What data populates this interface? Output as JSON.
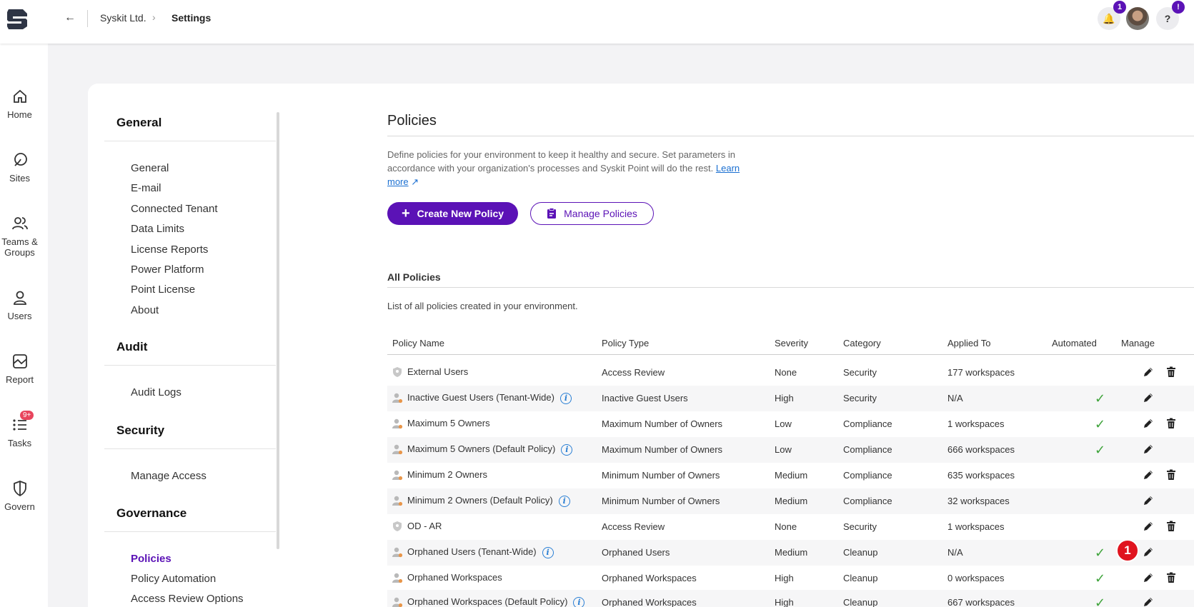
{
  "topbar": {
    "breadcrumb_org": "Syskit Ltd.",
    "breadcrumb_page": "Settings",
    "notifications_badge": "1",
    "help_badge": "!"
  },
  "leftnav": {
    "items": [
      {
        "label": "Home",
        "icon": "home-icon"
      },
      {
        "label": "Sites",
        "icon": "sites-icon"
      },
      {
        "label": "Teams & Groups",
        "icon": "teams-icon"
      },
      {
        "label": "Users",
        "icon": "user-icon"
      },
      {
        "label": "Report",
        "icon": "report-icon"
      },
      {
        "label": "Tasks",
        "icon": "tasks-icon",
        "badge": "9+"
      },
      {
        "label": "Govern",
        "icon": "shield-icon"
      }
    ]
  },
  "submenu": {
    "general_title": "General",
    "general_items": [
      "General",
      "E-mail",
      "Connected Tenant",
      "Data Limits",
      "License Reports",
      "Power Platform",
      "Point License",
      "About"
    ],
    "audit_title": "Audit",
    "audit_items": [
      "Audit Logs"
    ],
    "security_title": "Security",
    "security_items": [
      "Manage Access"
    ],
    "governance_title": "Governance",
    "governance_items": [
      "Policies",
      "Policy Automation",
      "Access Review Options"
    ]
  },
  "content": {
    "title": "Policies",
    "description": "Define policies for your environment to keep it healthy and secure. Set parameters in accordance with your organization's processes and Syskit Point will do the rest.",
    "learn_more": "Learn more",
    "create_button": "Create New Policy",
    "manage_button": "Manage Policies",
    "all_policies_title": "All Policies",
    "all_policies_desc": "List of all policies created in your environment."
  },
  "table": {
    "headers": [
      "Policy Name",
      "Policy Type",
      "Severity",
      "Category",
      "Applied To",
      "Automated",
      "Manage"
    ],
    "rows": [
      {
        "name": "External Users",
        "type": "Access Review",
        "severity": "None",
        "category": "Security",
        "applied": "177 workspaces",
        "automated": false,
        "info": false,
        "deletable": true
      },
      {
        "name": "Inactive Guest Users (Tenant-Wide)",
        "type": "Inactive Guest Users",
        "severity": "High",
        "category": "Security",
        "applied": "N/A",
        "automated": true,
        "info": true,
        "deletable": false
      },
      {
        "name": "Maximum 5 Owners",
        "type": "Maximum Number of Owners",
        "severity": "Low",
        "category": "Compliance",
        "applied": "1 workspaces",
        "automated": true,
        "info": false,
        "deletable": true
      },
      {
        "name": "Maximum 5 Owners (Default Policy)",
        "type": "Maximum Number of Owners",
        "severity": "Low",
        "category": "Compliance",
        "applied": "666 workspaces",
        "automated": true,
        "info": true,
        "deletable": false
      },
      {
        "name": "Minimum 2 Owners",
        "type": "Minimum Number of Owners",
        "severity": "Medium",
        "category": "Compliance",
        "applied": "635 workspaces",
        "automated": false,
        "info": false,
        "deletable": true
      },
      {
        "name": "Minimum 2 Owners (Default Policy)",
        "type": "Minimum Number of Owners",
        "severity": "Medium",
        "category": "Compliance",
        "applied": "32 workspaces",
        "automated": false,
        "info": true,
        "deletable": false
      },
      {
        "name": "OD - AR",
        "type": "Access Review",
        "severity": "None",
        "category": "Security",
        "applied": "1 workspaces",
        "automated": false,
        "info": false,
        "deletable": true
      },
      {
        "name": "Orphaned Users (Tenant-Wide)",
        "type": "Orphaned Users",
        "severity": "Medium",
        "category": "Cleanup",
        "applied": "N/A",
        "automated": true,
        "info": true,
        "deletable": false
      },
      {
        "name": "Orphaned Workspaces",
        "type": "Orphaned Workspaces",
        "severity": "High",
        "category": "Cleanup",
        "applied": "0 workspaces",
        "automated": true,
        "info": false,
        "deletable": true
      },
      {
        "name": "Orphaned Workspaces (Default Policy)",
        "type": "Orphaned Workspaces",
        "severity": "High",
        "category": "Cleanup",
        "applied": "667 workspaces",
        "automated": true,
        "info": true,
        "deletable": false
      }
    ]
  },
  "annotation_marker": "1",
  "colors": {
    "accent": "#5b12b6",
    "check": "#3ea33a",
    "marker": "#e0141f"
  }
}
